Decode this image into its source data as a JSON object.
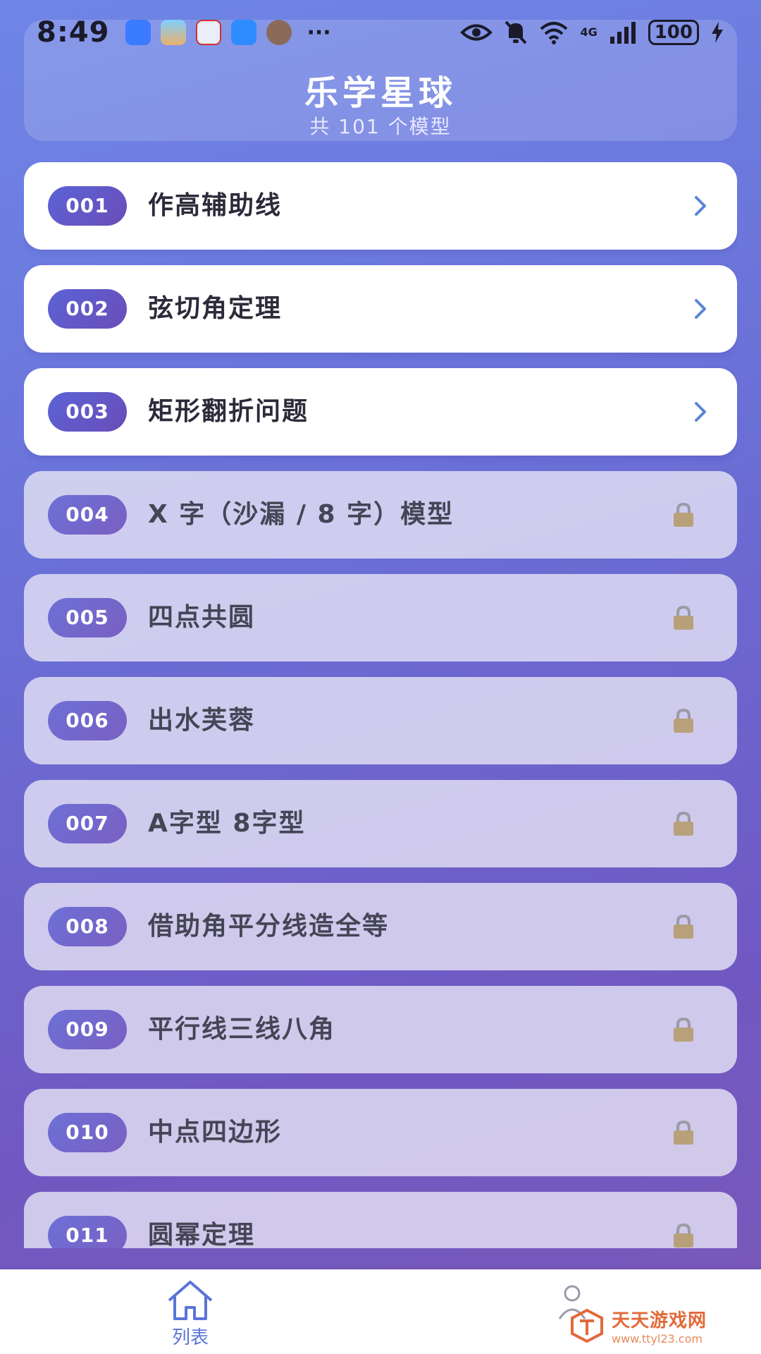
{
  "status_bar": {
    "time": "8:49",
    "more": "···",
    "network": "4G",
    "battery": "100",
    "notification_icons": [
      "usb-icon",
      "photo-app-icon",
      "mail-app-icon",
      "message-app-icon",
      "avatar-app-icon"
    ],
    "status_icons": [
      "eye-icon",
      "bell-off-icon",
      "wifi-icon",
      "signal-icon",
      "charging-icon"
    ]
  },
  "header": {
    "title": "乐学星球",
    "subtitle": "共 101 个模型"
  },
  "items": [
    {
      "number": "001",
      "title": "作高辅助线",
      "locked": false
    },
    {
      "number": "002",
      "title": "弦切角定理",
      "locked": false
    },
    {
      "number": "003",
      "title": "矩形翻折问题",
      "locked": false
    },
    {
      "number": "004",
      "title": "X 字（沙漏 / 8 字）模型",
      "locked": true
    },
    {
      "number": "005",
      "title": "四点共圆",
      "locked": true
    },
    {
      "number": "006",
      "title": "出水芙蓉",
      "locked": true
    },
    {
      "number": "007",
      "title": "A字型 8字型",
      "locked": true
    },
    {
      "number": "008",
      "title": "借助角平分线造全等",
      "locked": true
    },
    {
      "number": "009",
      "title": "平行线三线八角",
      "locked": true
    },
    {
      "number": "010",
      "title": "中点四边形",
      "locked": true
    },
    {
      "number": "011",
      "title": "圆幂定理",
      "locked": true
    }
  ],
  "bottom_nav": {
    "home_label": "列表"
  },
  "watermark": {
    "title": "天天游戏网",
    "url": "www.ttyl23.com"
  },
  "colors": {
    "accent": "#5a74d8",
    "badge": "#5b63d6",
    "chevron": "#5b86d8",
    "lock": "#b8a07a"
  }
}
